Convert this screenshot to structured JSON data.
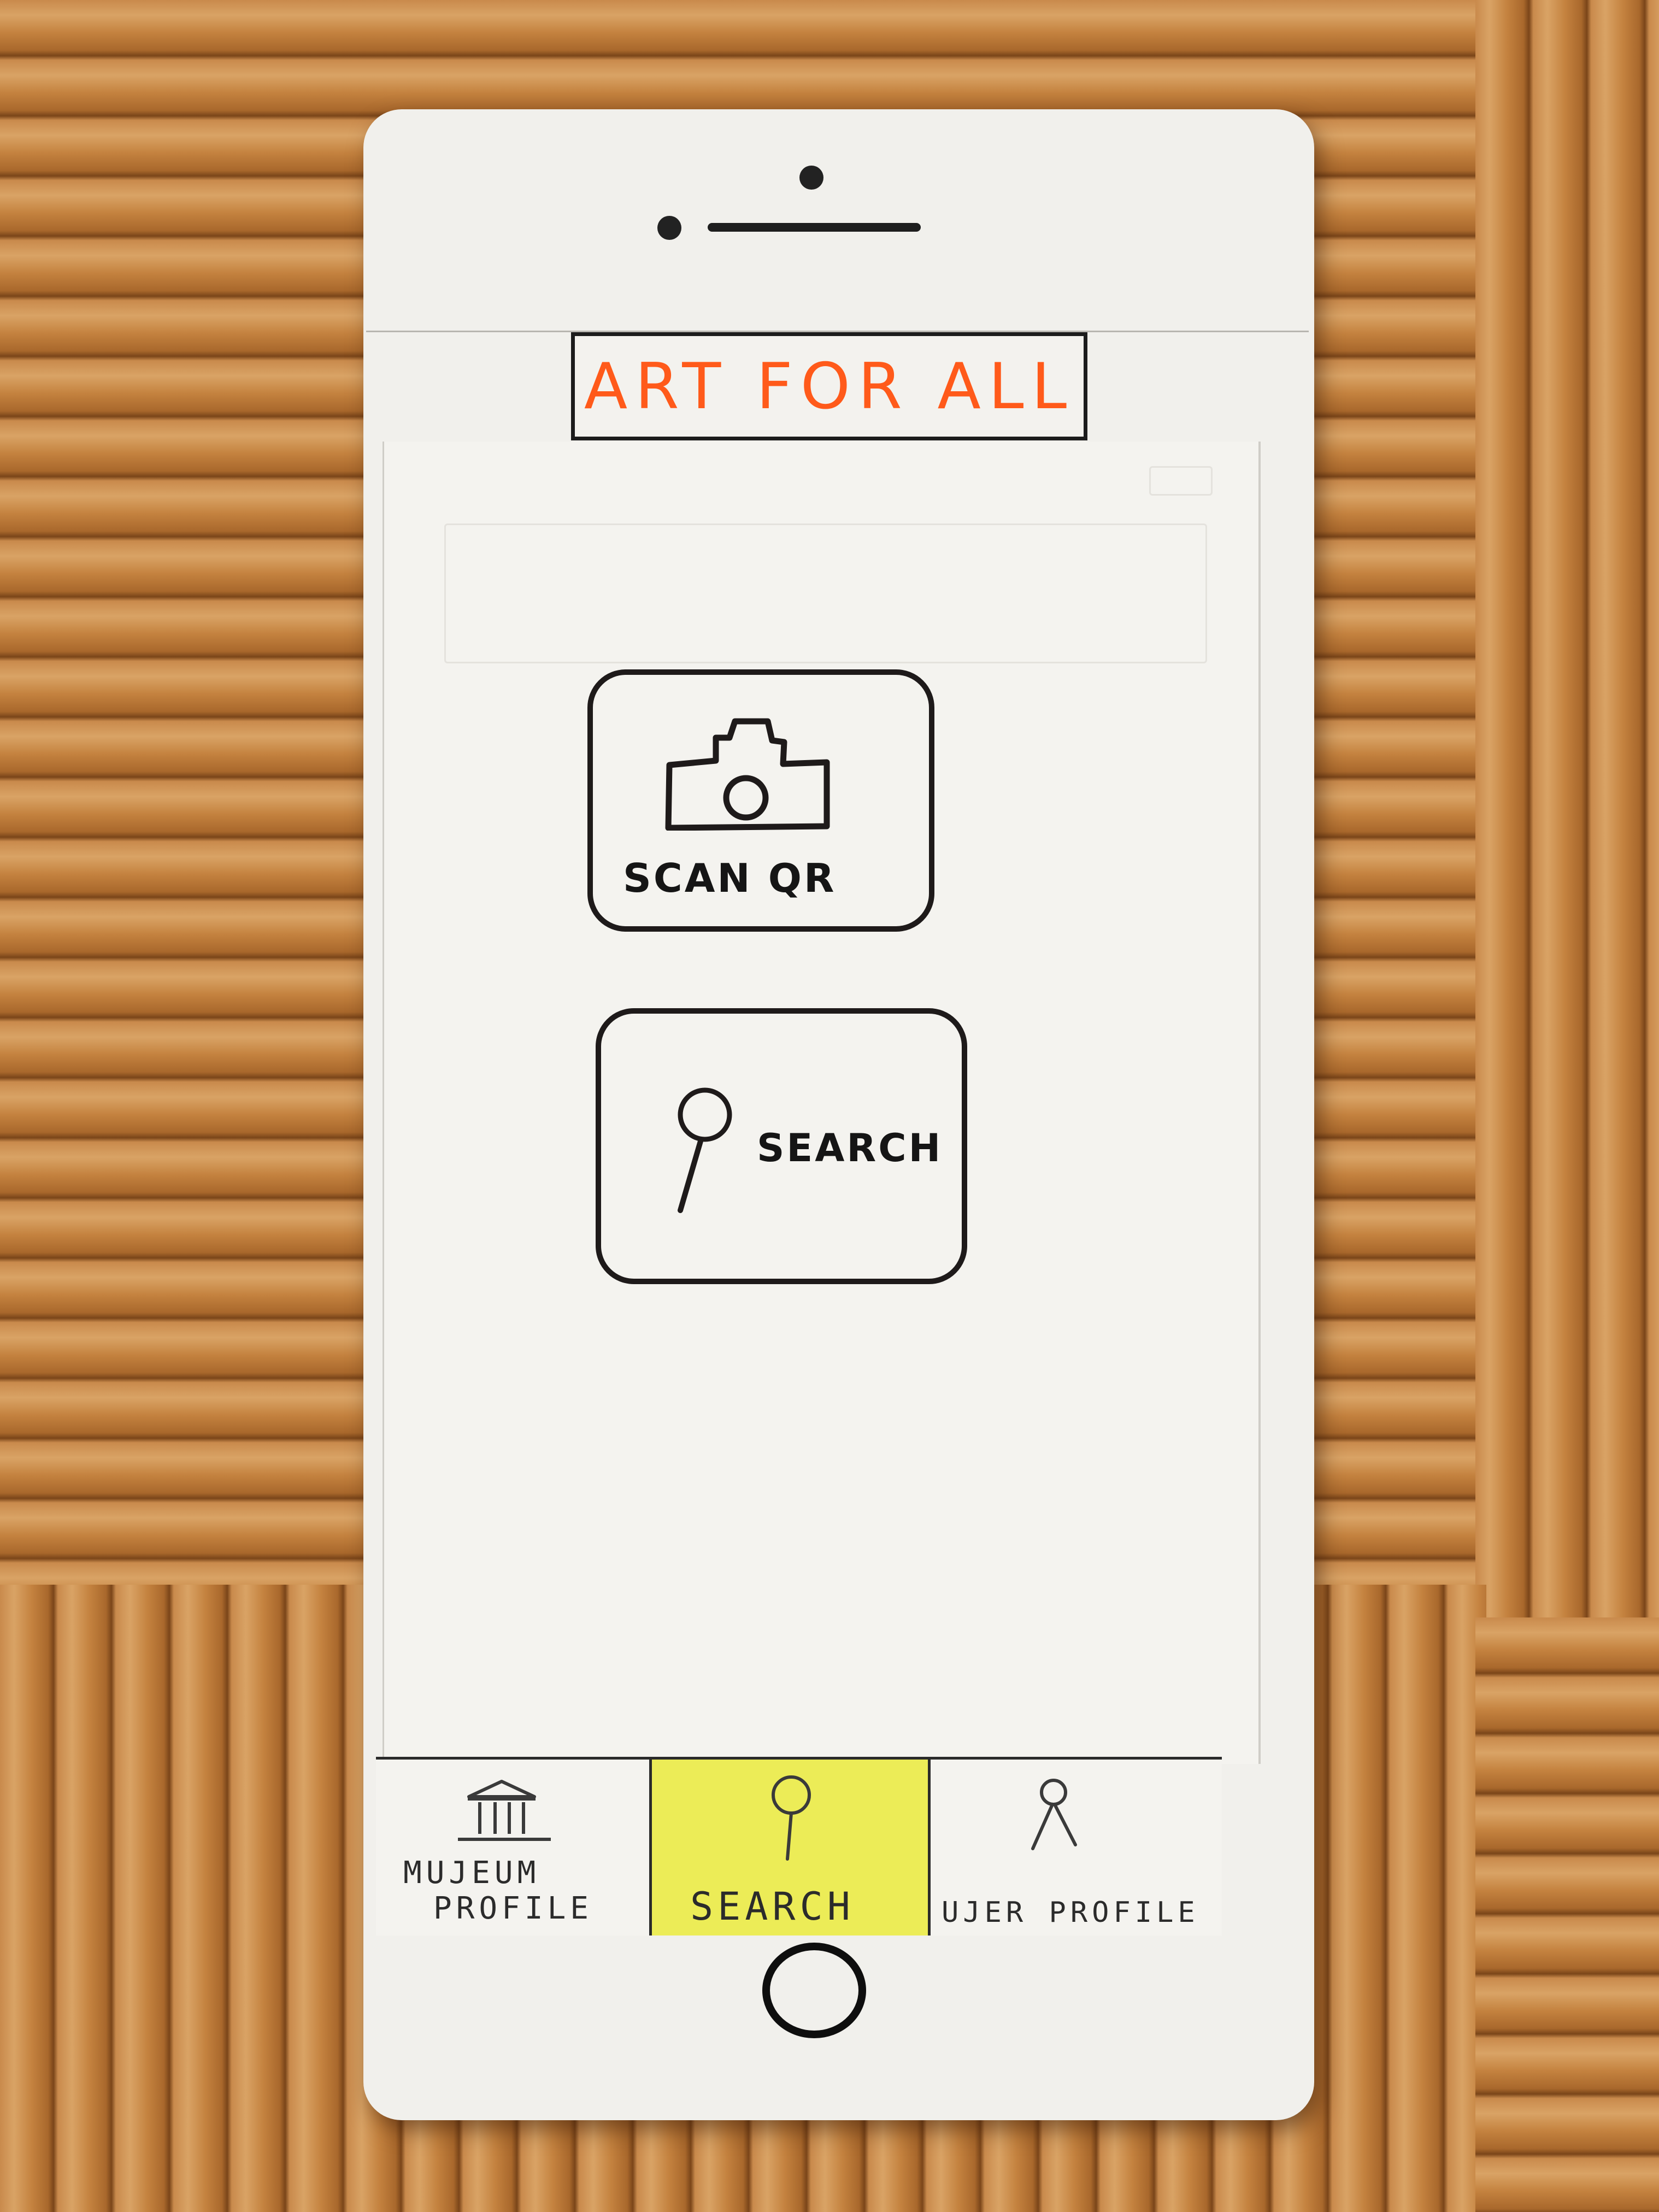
{
  "app": {
    "title": "ART FOR ALL"
  },
  "main": {
    "scan_card": {
      "label": "SCAN QR",
      "icon": "camera-icon"
    },
    "search_card": {
      "label": "SEARCH",
      "icon": "search-icon"
    }
  },
  "tabbar": {
    "active_tab": "search",
    "active_color": "#ecec57",
    "items": [
      {
        "id": "museum",
        "label_line1": "MUJEUM",
        "label_line2": "PROFILE",
        "icon": "museum-icon"
      },
      {
        "id": "search",
        "label": "SEARCH",
        "icon": "search-icon"
      },
      {
        "id": "user",
        "label": "UJER PROFILE",
        "icon": "user-icon"
      }
    ]
  },
  "colors": {
    "title": "#ff5a1a",
    "ink": "#1e1a1a",
    "paper": "#f1f0ec"
  }
}
